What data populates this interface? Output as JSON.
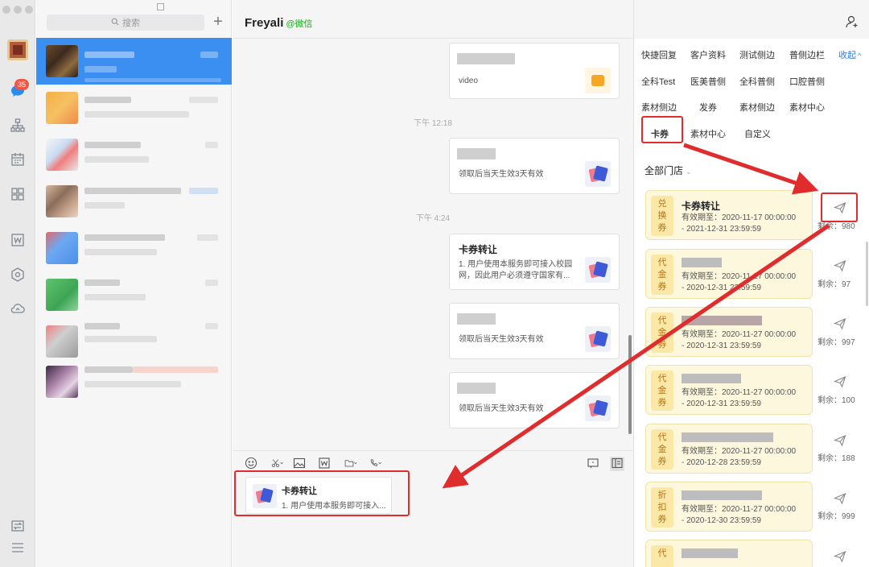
{
  "rail": {
    "unread_badge": "35",
    "icons": [
      "chat-icon",
      "org-icon",
      "calendar-icon",
      "apps-icon",
      "doc-icon",
      "cube-icon",
      "cloud-icon",
      "switch-icon",
      "menu-icon"
    ]
  },
  "conversations": {
    "search_placeholder": "搜索",
    "add_label": "+"
  },
  "chat": {
    "title": "Freyali",
    "subtitle": "@微信",
    "messages": [
      {
        "kind": "video",
        "desc": "video"
      },
      {
        "kind": "time",
        "text": "下午 12:18"
      },
      {
        "kind": "coupon",
        "desc": "领取后当天生效3天有效"
      },
      {
        "kind": "time",
        "text": "下午 4:24"
      },
      {
        "kind": "coupon",
        "title": "卡券转让",
        "desc": "1. 用户使用本服务即可接入校园网，因此用户必须遵守国家有..."
      },
      {
        "kind": "coupon",
        "desc": "领取后当天生效3天有效"
      },
      {
        "kind": "coupon",
        "desc": "领取后当天生效3天有效"
      }
    ],
    "draft": {
      "title": "卡券转让",
      "desc": "1. 用户使用本服务即可接入..."
    }
  },
  "side": {
    "tabs_row1": [
      "快捷回复",
      "客户资料",
      "测试侧边",
      "普侧边栏"
    ],
    "collapse_label": "收起",
    "tabs_row2": [
      "全科Test",
      "医美普侧",
      "全科普侧",
      "口腔普侧"
    ],
    "tabs_row3": [
      "素材侧边",
      "发券",
      "素材侧边",
      "素材中心"
    ],
    "tabs_row4": [
      "卡券",
      "素材中心",
      "自定义"
    ],
    "store": "全部门店",
    "coupons": [
      {
        "type": "兑换券",
        "name": "卡券转让",
        "valid1": "有效期至：2020-11-17 00:00:00",
        "valid2": "- 2021-12-31 23:59:59",
        "remain": "剩余：980"
      },
      {
        "type": "代金券",
        "name": "",
        "valid1": "有效期至：2020-11-27 00:00:00",
        "valid2": "- 2020-12-31 23:59:59",
        "remain": "剩余：97"
      },
      {
        "type": "代金券",
        "name": "",
        "valid1": "有效期至：2020-11-27 00:00:00",
        "valid2": "- 2020-12-31 23:59:59",
        "remain": "剩余：997"
      },
      {
        "type": "代金券",
        "name": "",
        "valid1": "有效期至：2020-11-27 00:00:00",
        "valid2": "- 2020-12-31 23:59:59",
        "remain": "剩余：100"
      },
      {
        "type": "代金券",
        "name": "",
        "valid1": "有效期至：2020-11-27 00:00:00",
        "valid2": "- 2020-12-28 23:59:59",
        "remain": "剩余：188"
      },
      {
        "type": "折扣券",
        "name": "",
        "valid1": "有效期至：2020-11-27 00:00:00",
        "valid2": "- 2020-12-30 23:59:59",
        "remain": "剩余：999"
      },
      {
        "type": "代",
        "name": "",
        "valid1": "",
        "valid2": "",
        "remain": ""
      }
    ]
  },
  "colors": {
    "active_conversation": "#3a8ff0",
    "annotation_red": "#e02c2c",
    "coupon_bg": "#fdf7de",
    "accent_blue": "#2f7be4",
    "wechat_green": "#1aad19"
  }
}
